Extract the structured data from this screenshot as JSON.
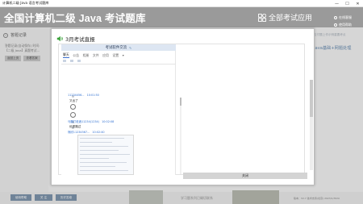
{
  "window": {
    "title": "计算机二级 Java 语言考试题库",
    "minimize": "—",
    "maximize": "☐",
    "close": "✕"
  },
  "header": {
    "app_title": "全国计算机二级 Java 考试题库",
    "all_exams_label": "全部考试应用",
    "links": [
      "在线客服",
      "使用帮助"
    ]
  },
  "left_panel": {
    "back_label": "答题记录",
    "info_lines": [
      "答题记录(自动保存) 时间:",
      "【二级 Java】真题考试..."
    ],
    "buttons": [
      "返回上页",
      "查看答案"
    ]
  },
  "right_strip": {
    "text": "应付题上作示例重要考点",
    "blue_text": "Java基础+网题处理"
  },
  "bottom": {
    "buttons": [
      "使用帮助",
      "关 注",
      "历史答卷"
    ],
    "notice": "学习题系列已确切联系",
    "version": "版本：V2.7 技术支持(北京)  2023/1/30dz"
  },
  "modal": {
    "title": "3月考试直报",
    "close_label": "关闭",
    "phone": {
      "group_title": "考试软件交流",
      "tabs": [
        "聊天",
        "公告",
        "相册",
        "文件",
        "应用",
        "设置"
      ],
      "tab_more": "▾",
      "messages": [
        {
          "name": "11234456...",
          "time": "10:01:50",
          "text": "又出了"
        },
        {
          "name": "马鹏打老酒11234(1234)",
          "time": "10:02:08",
          "text": ""
        },
        {
          "name": "熊欣11234567...",
          "time": "10:02:40",
          "text": "优秀路过"
        }
      ]
    }
  },
  "icons": {
    "speaker": "speaker-icon",
    "grid": "apps-grid-icon",
    "emoji": "emoji-icon"
  },
  "colors": {
    "accent_blue": "#2f6fd1",
    "header_gray": "#9a9a9a",
    "button_blue": "#7f96ad"
  }
}
